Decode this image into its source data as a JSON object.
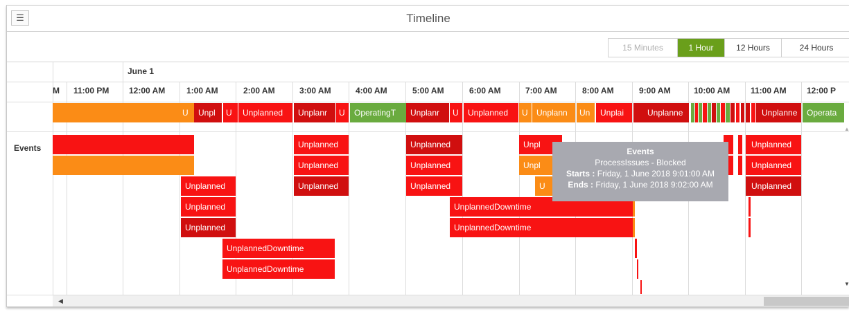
{
  "header": {
    "title": "Timeline",
    "menu_icon": "hamburger-menu-icon"
  },
  "toolbar": {
    "buttons": [
      {
        "label": "15 Minutes",
        "state": "disabled"
      },
      {
        "label": "1 Hour",
        "state": "active"
      },
      {
        "label": "12 Hours",
        "state": "normal"
      },
      {
        "label": "24 Hours",
        "state": "normal"
      }
    ]
  },
  "timeline": {
    "day_label": "June 1",
    "hours": [
      "M",
      "11:00 PM",
      "12:00 AM",
      "1:00 AM",
      "2:00 AM",
      "3:00 AM",
      "4:00 AM",
      "5:00 AM",
      "6:00 AM",
      "7:00 AM",
      "8:00 AM",
      "9:00 AM",
      "10:00 AM",
      "11:00 AM",
      "12:00 P"
    ],
    "row_label": "Events"
  },
  "state_bars": [
    "U",
    "Unpl",
    "U",
    "Unplanned",
    "Unplanr",
    "U",
    "OperatingT",
    "Unplanr",
    "U",
    "Unplanned",
    "U",
    "Unplann",
    "Un",
    "Unplai",
    "Unplanne",
    "Unplanne",
    "Operata"
  ],
  "events": {
    "unplanned": "Unplanned",
    "unplanned_downtime": "UnplannedDowntime",
    "unplanned_cut": "Unpl",
    "u_cut": "U"
  },
  "tooltip": {
    "title": "Events",
    "subtitle": "ProcessIssues - Blocked",
    "starts_label": "Starts :",
    "starts_value": "Friday, 1 June 2018 9:01:00 AM",
    "ends_label": "Ends :",
    "ends_value": "Friday, 1 June 2018 9:02:00 AM"
  },
  "colors": {
    "orange": "#fb8c16",
    "red": "#f81313",
    "dark_red": "#d00f0f",
    "green": "#6aab3f",
    "active_button": "#6a9f1b",
    "tooltip": "#a8a9b0"
  }
}
